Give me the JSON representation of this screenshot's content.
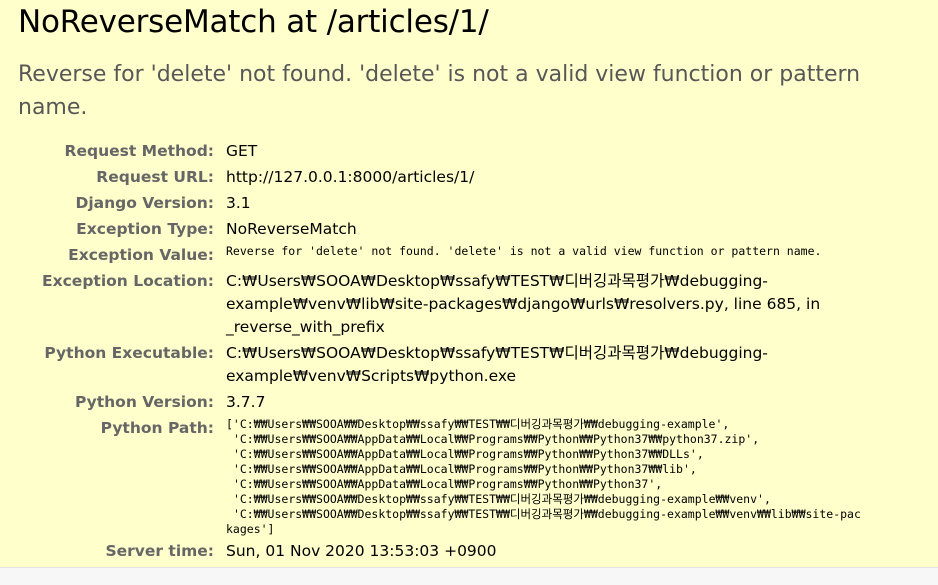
{
  "title": "NoReverseMatch at /articles/1/",
  "exception_message": "Reverse for 'delete' not found. 'delete' is not a valid view function or pattern name.",
  "meta": {
    "request_method": {
      "label": "Request Method:",
      "value": "GET"
    },
    "request_url": {
      "label": "Request URL:",
      "value": "http://127.0.0.1:8000/articles/1/"
    },
    "django_version": {
      "label": "Django Version:",
      "value": "3.1"
    },
    "exception_type": {
      "label": "Exception Type:",
      "value": "NoReverseMatch"
    },
    "exception_value": {
      "label": "Exception Value:",
      "value": "Reverse for 'delete' not found. 'delete' is not a valid view function or pattern name."
    },
    "exception_location": {
      "label": "Exception Location:",
      "value": "C:₩Users₩SOOA₩Desktop₩ssafy₩TEST₩디버깅과목평가₩debugging-example₩venv₩lib₩site-packages₩django₩urls₩resolvers.py, line 685, in _reverse_with_prefix"
    },
    "python_executable": {
      "label": "Python Executable:",
      "value": "C:₩Users₩SOOA₩Desktop₩ssafy₩TEST₩디버깅과목평가₩debugging-example₩venv₩Scripts₩python.exe"
    },
    "python_version": {
      "label": "Python Version:",
      "value": "3.7.7"
    },
    "python_path": {
      "label": "Python Path:",
      "value": "['C:₩₩Users₩₩SOOA₩₩Desktop₩₩ssafy₩₩TEST₩₩디버깅과목평가₩₩debugging-example',\n 'C:₩₩Users₩₩SOOA₩₩AppData₩₩Local₩₩Programs₩₩Python₩₩Python37₩₩python37.zip',\n 'C:₩₩Users₩₩SOOA₩₩AppData₩₩Local₩₩Programs₩₩Python₩₩Python37₩₩DLLs',\n 'C:₩₩Users₩₩SOOA₩₩AppData₩₩Local₩₩Programs₩₩Python₩₩Python37₩₩lib',\n 'C:₩₩Users₩₩SOOA₩₩AppData₩₩Local₩₩Programs₩₩Python₩₩Python37',\n 'C:₩₩Users₩₩SOOA₩₩Desktop₩₩ssafy₩₩TEST₩₩디버깅과목평가₩₩debugging-example₩₩venv',\n 'C:₩₩Users₩₩SOOA₩₩Desktop₩₩ssafy₩₩TEST₩₩디버깅과목평가₩₩debugging-example₩₩venv₩₩lib₩₩site-packages']"
    },
    "server_time": {
      "label": "Server time:",
      "value": "Sun, 01 Nov 2020 13:53:03 +0900"
    }
  }
}
